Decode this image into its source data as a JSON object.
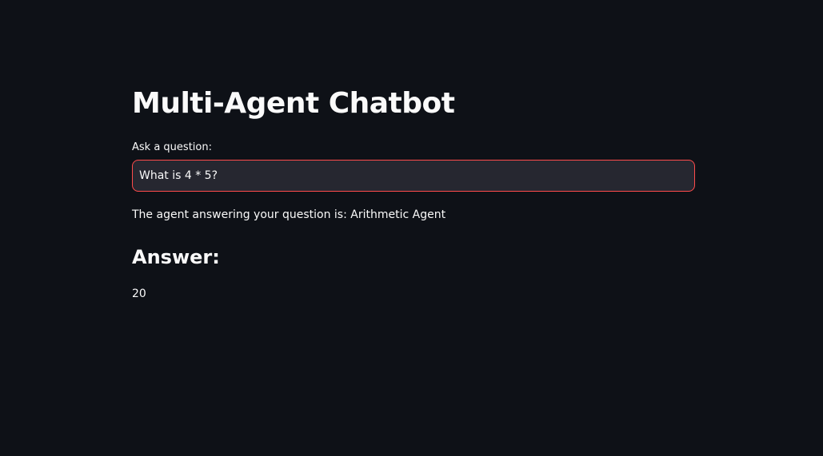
{
  "app": {
    "title": "Multi-Agent Chatbot"
  },
  "question": {
    "label": "Ask a question:",
    "value": "What is 4 * 5?"
  },
  "agent": {
    "text": "The agent answering your question is: Arithmetic Agent"
  },
  "answer": {
    "heading": "Answer:",
    "value": "20"
  },
  "colors": {
    "background": "#0e1117",
    "input_background": "#262730",
    "input_border_focus": "#ff4b4b",
    "text": "#fafafa"
  }
}
